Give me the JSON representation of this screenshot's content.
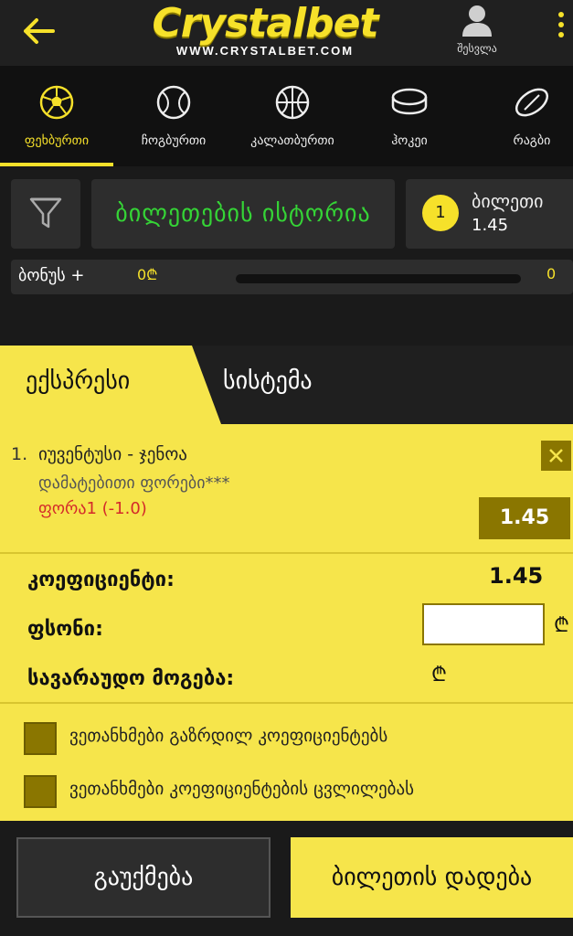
{
  "header": {
    "logo_main": "Crystalbet",
    "logo_sub": "WWW.CRYSTALBET.COM",
    "login_label": "შესვლა"
  },
  "sports": [
    {
      "label": "ფეხბურთი",
      "icon": "soccer-ball-icon",
      "active": true
    },
    {
      "label": "ჩოგბურთი",
      "icon": "tennis-ball-icon",
      "active": false
    },
    {
      "label": "კალათბურთი",
      "icon": "basketball-icon",
      "active": false
    },
    {
      "label": "ჰოკეი",
      "icon": "hockey-puck-icon",
      "active": false
    },
    {
      "label": "რაგბი",
      "icon": "rugby-ball-icon",
      "active": false
    }
  ],
  "toolbar": {
    "history_label": "ბილეთების ისტორია",
    "ticket_count": "1",
    "ticket_label": "ბილეთი",
    "ticket_odds": "1.45"
  },
  "bonus": {
    "label": "ბონუს +",
    "amount": "0₾",
    "count": "0"
  },
  "slip": {
    "tab_express": "ექსპრესი",
    "tab_system": "სისტემა",
    "bet": {
      "number": "1.",
      "teams": "იუვენტუსი - ჯენოა",
      "market": "დამატებითი ფორები***",
      "pick": "ფორა1 (-1.0)",
      "odds": "1.45"
    },
    "coef_label": "კოეფიციენტი:",
    "coef_value": "1.45",
    "stake_label": "ფსონი:",
    "stake_value": "",
    "win_label": "სავარაუდო მოგება:",
    "currency": "₾",
    "agree_increase": "ვეთანხმები გაზრდილ კოეფიციენტებს",
    "agree_change": "ვეთანხმები კოეფიციენტების ცვლილებას"
  },
  "footer": {
    "cancel_label": "გაუქმება",
    "place_label": "ბილეთის დადება"
  },
  "colors": {
    "accent": "#f6e12a",
    "slip_bg": "#f6e54b",
    "dark_olive": "#8a7600",
    "green_text": "#35d436",
    "red_text": "#d42a2a"
  }
}
